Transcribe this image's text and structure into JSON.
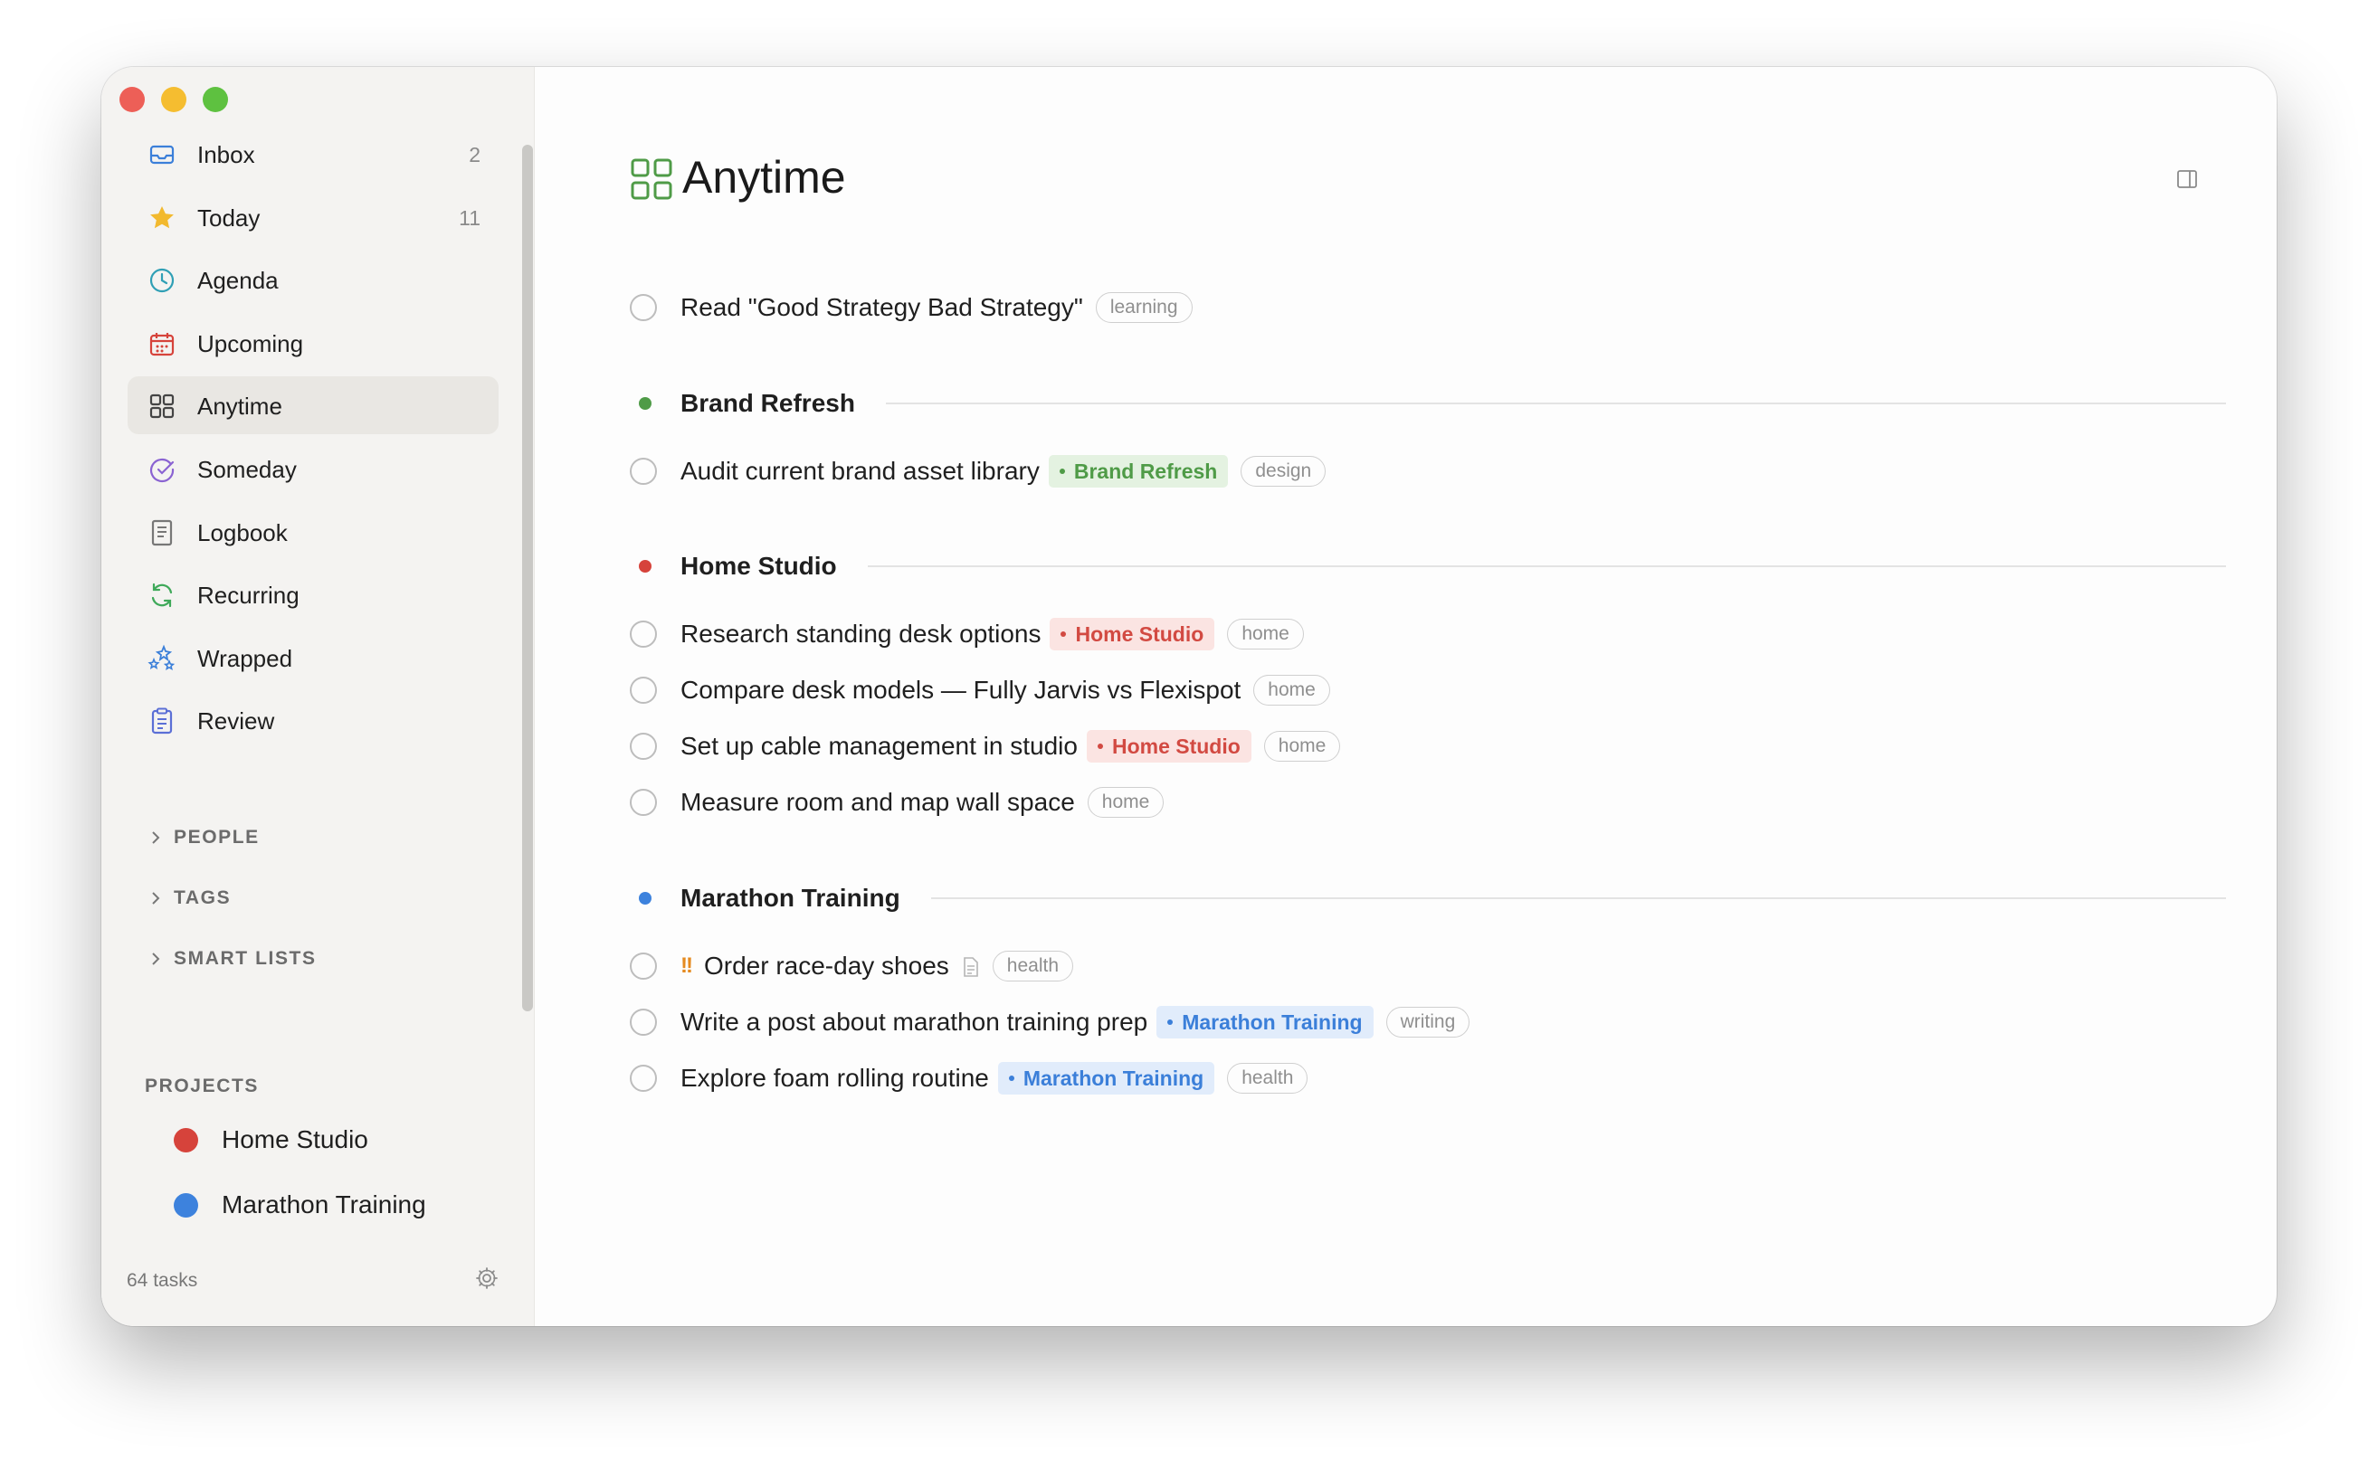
{
  "sidebar": {
    "nav": [
      {
        "label": "Inbox",
        "count": "2",
        "icon": "inbox-icon"
      },
      {
        "label": "Today",
        "count": "11",
        "icon": "star-icon"
      },
      {
        "label": "Agenda",
        "count": "",
        "icon": "clock-icon"
      },
      {
        "label": "Upcoming",
        "count": "",
        "icon": "calendar-icon"
      },
      {
        "label": "Anytime",
        "count": "",
        "icon": "grid-icon",
        "active": true
      },
      {
        "label": "Someday",
        "count": "",
        "icon": "someday-icon"
      },
      {
        "label": "Logbook",
        "count": "",
        "icon": "logbook-icon"
      },
      {
        "label": "Recurring",
        "count": "",
        "icon": "recurring-icon"
      },
      {
        "label": "Wrapped",
        "count": "",
        "icon": "sparkles-icon"
      },
      {
        "label": "Review",
        "count": "",
        "icon": "clipboard-icon"
      }
    ],
    "sections": {
      "people": "PEOPLE",
      "tags": "TAGS",
      "smart_lists": "SMART LISTS"
    },
    "projects_heading": "PROJECTS",
    "projects": [
      {
        "label": "Home Studio",
        "color": "#d6433b"
      },
      {
        "label": "Marathon Training",
        "color": "#3d82dd"
      }
    ],
    "footer_count": "64 tasks"
  },
  "main": {
    "title": "Anytime",
    "standalone": {
      "title": "Read \"Good Strategy Bad Strategy\"",
      "tag": "learning"
    },
    "groups": [
      {
        "title": "Brand Refresh",
        "color": "#4f9b47",
        "tasks": [
          {
            "title": "Audit current brand asset library",
            "project": "Brand Refresh",
            "tag": "design"
          }
        ]
      },
      {
        "title": "Home Studio",
        "color": "#d6433b",
        "tasks": [
          {
            "title": "Research standing desk options",
            "project": "Home Studio",
            "tag": "home"
          },
          {
            "title": "Compare desk models — Fully Jarvis vs Flexispot",
            "project": "",
            "tag": "home"
          },
          {
            "title": "Set up cable management in studio",
            "project": "Home Studio",
            "tag": "home"
          },
          {
            "title": "Measure room and map wall space",
            "project": "",
            "tag": "home"
          }
        ]
      },
      {
        "title": "Marathon Training",
        "color": "#3d82dd",
        "tasks": [
          {
            "title": "Order race-day shoes",
            "priority": "!!",
            "project": "",
            "tag": "health",
            "has_note": true
          },
          {
            "title": "Write a post about marathon training prep",
            "project": "Marathon Training",
            "tag": "writing"
          },
          {
            "title": "Explore foam rolling routine",
            "project": "Marathon Training",
            "tag": "health"
          }
        ]
      }
    ]
  },
  "colors": {
    "accent_green": "#4f9b47",
    "accent_red": "#d6433b",
    "accent_blue": "#3d82dd",
    "priority": "#e58a1f"
  }
}
